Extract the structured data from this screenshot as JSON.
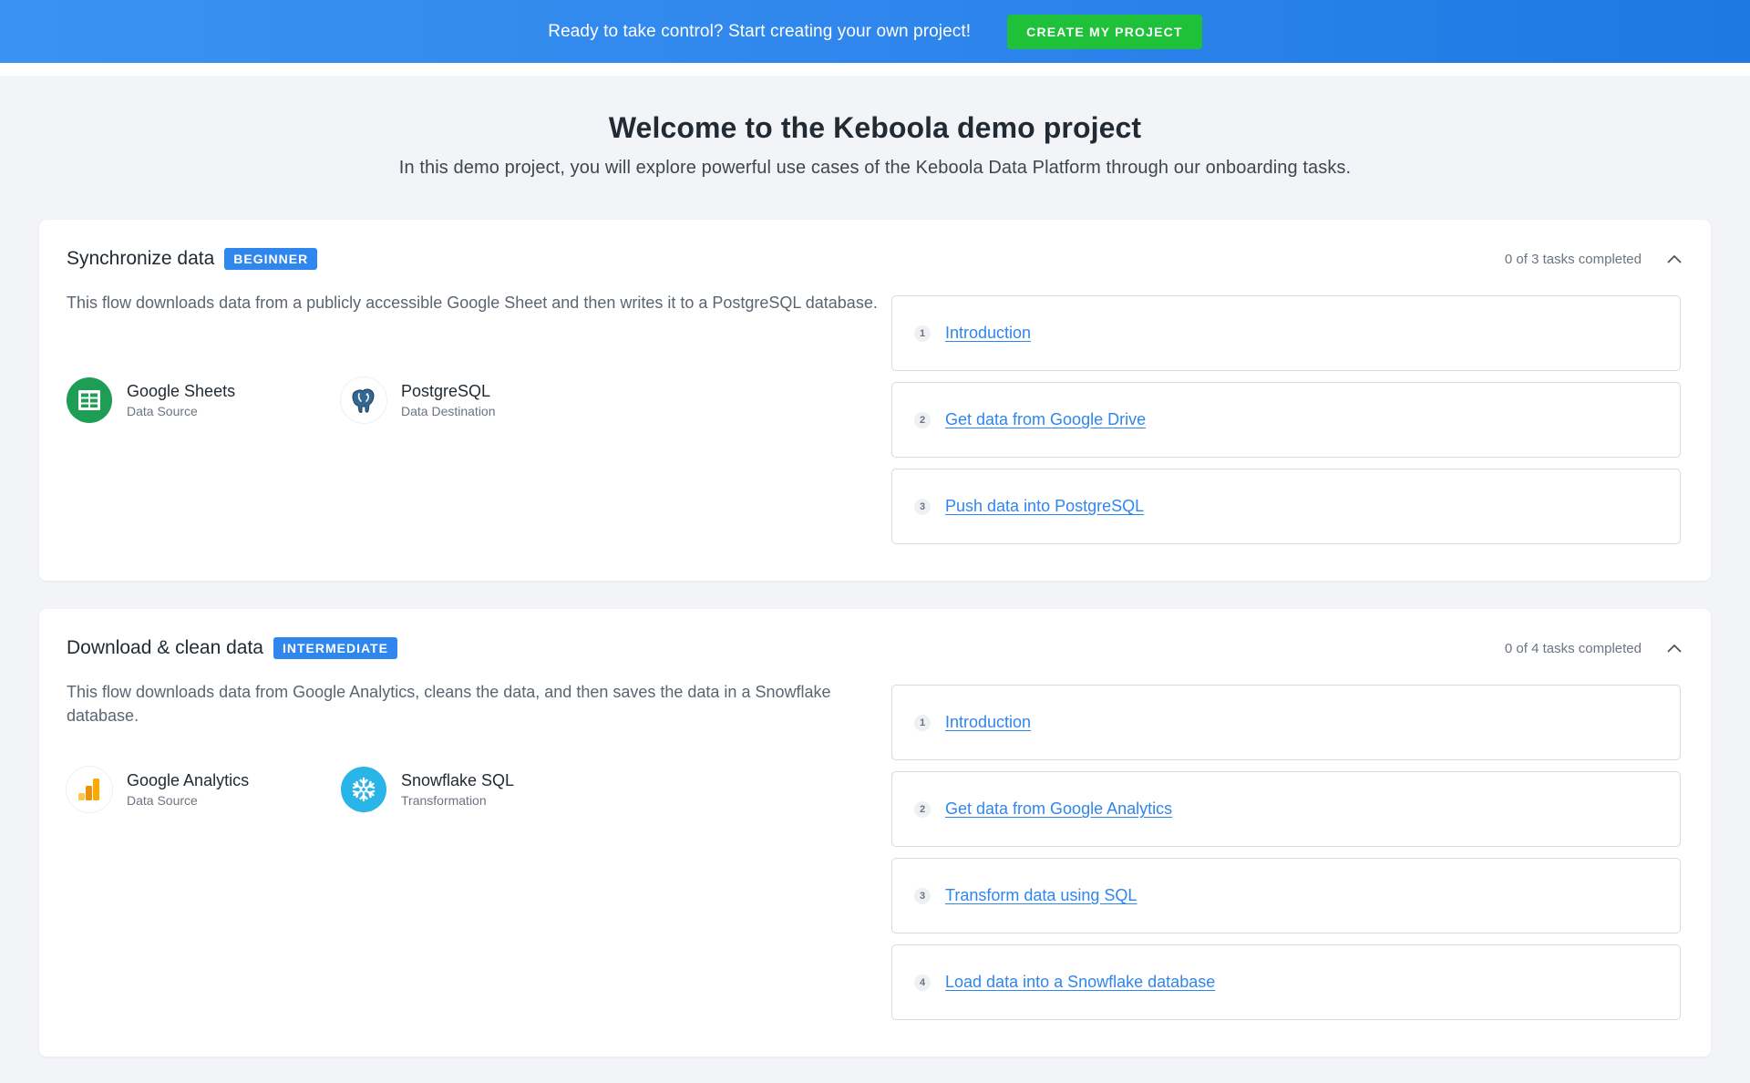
{
  "banner": {
    "text": "Ready to take control? Start creating your own project!",
    "button_label": "CREATE MY PROJECT"
  },
  "welcome": {
    "title": "Welcome to the Keboola demo project",
    "subtitle": "In this demo project, you will explore powerful use cases of the Keboola Data Platform through our onboarding tasks."
  },
  "flows": [
    {
      "title": "Synchronize data",
      "level": "BEGINNER",
      "progress": "0 of 3 tasks completed",
      "description": "This flow downloads data from a publicly accessible Google Sheet and then writes it to a PostgreSQL database.",
      "components": [
        {
          "name": "Google Sheets",
          "type": "Data Source",
          "icon": "google-sheets-icon"
        },
        {
          "name": "PostgreSQL",
          "type": "Data Destination",
          "icon": "postgresql-icon"
        }
      ],
      "tasks": [
        {
          "num": "1",
          "label": "Introduction"
        },
        {
          "num": "2",
          "label": "Get data from Google Drive"
        },
        {
          "num": "3",
          "label": "Push data into PostgreSQL"
        }
      ]
    },
    {
      "title": "Download & clean data",
      "level": "INTERMEDIATE",
      "progress": "0 of 4 tasks completed",
      "description": "This flow downloads data from Google Analytics, cleans the data, and then saves the data in a Snowflake database.",
      "components": [
        {
          "name": "Google Analytics",
          "type": "Data Source",
          "icon": "google-analytics-icon"
        },
        {
          "name": "Snowflake SQL",
          "type": "Transformation",
          "icon": "snowflake-icon"
        }
      ],
      "tasks": [
        {
          "num": "1",
          "label": "Introduction"
        },
        {
          "num": "2",
          "label": "Get data from Google Analytics"
        },
        {
          "num": "3",
          "label": "Transform data using SQL"
        },
        {
          "num": "4",
          "label": "Load data into a Snowflake database"
        }
      ]
    }
  ],
  "colors": {
    "accent": "#2f86ec",
    "cta": "#1fc13a",
    "background": "#f2f4f7"
  }
}
